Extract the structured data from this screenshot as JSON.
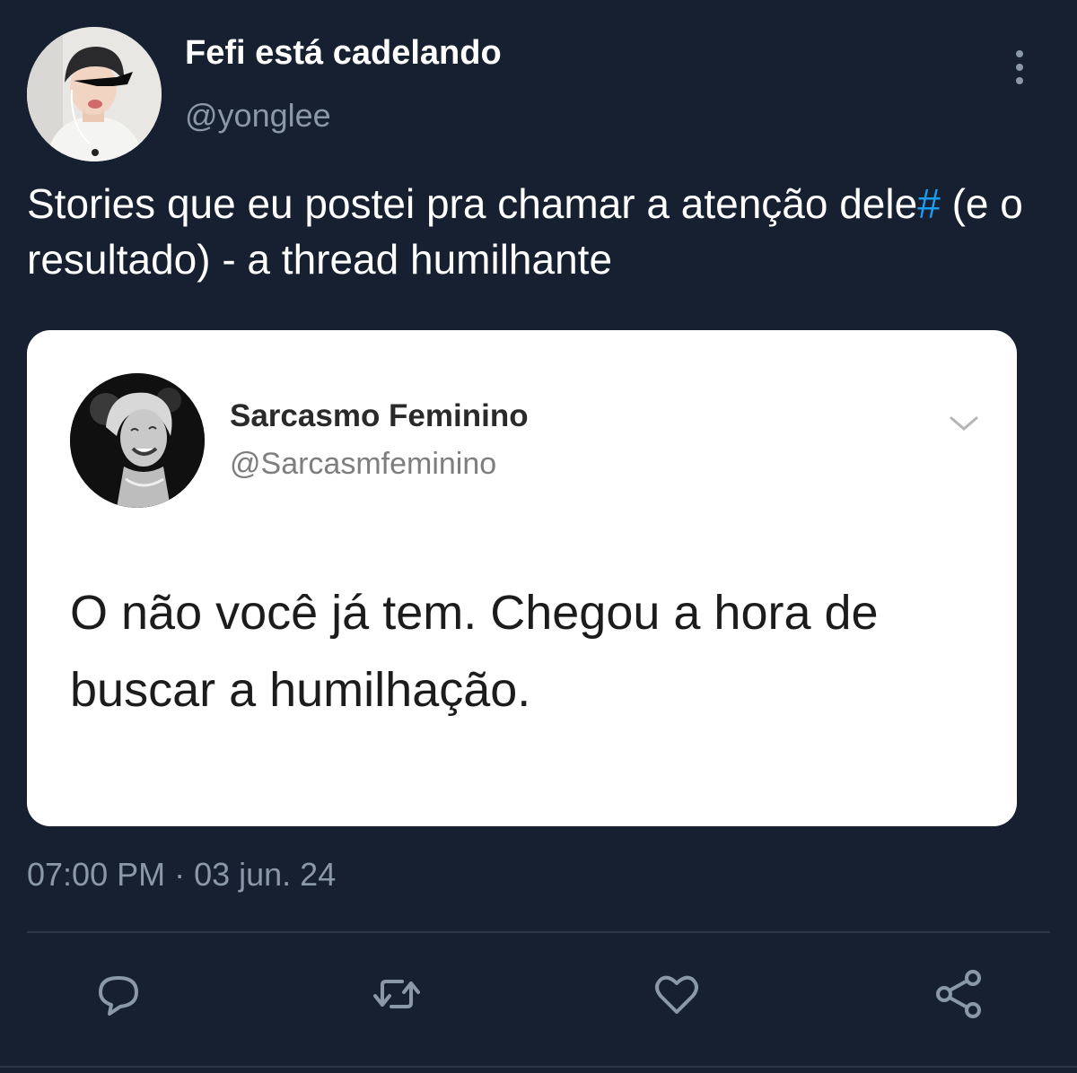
{
  "tweet": {
    "author": {
      "display_name": "Fefi está cadelando",
      "handle": "@yonglee"
    },
    "text_before": "Stories que eu postei pra chamar a atenção dele",
    "hashtag": "#",
    "text_after": " (e o resultado) - a thread humilhante",
    "timestamp": "07:00 PM · 03 jun. 24"
  },
  "embedded_image": {
    "author": {
      "display_name": "Sarcasmo Feminino",
      "handle": "@Sarcasmfeminino"
    },
    "text": "O não você já tem. Chegou a hora de buscar a humilhação."
  },
  "icons": {
    "more": "more-vertical-icon",
    "chevron": "chevron-down-icon",
    "reply": "reply-icon",
    "retweet": "retweet-icon",
    "like": "heart-icon",
    "share": "share-icon"
  },
  "colors": {
    "background": "#162030",
    "hashtag": "#1d9bf0",
    "secondary_text": "#8b98a8",
    "card_background": "#ffffff"
  }
}
